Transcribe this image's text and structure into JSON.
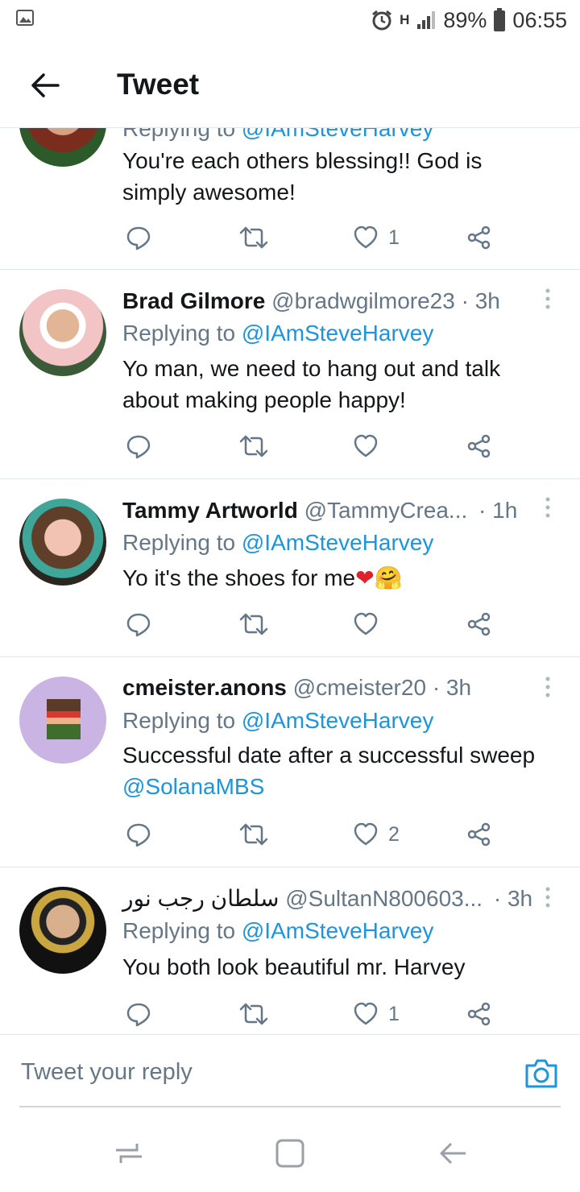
{
  "status_bar": {
    "signal": "H",
    "battery": "89%",
    "time": "06:55"
  },
  "header": {
    "title": "Tweet"
  },
  "tweets": [
    {
      "name": "",
      "handle": "",
      "time": "",
      "replying_prefix": "Replying to",
      "replying_to": "@IAmSteveHarvey",
      "text": "You're each others blessing!!  God is simply awesome!",
      "likes": "1"
    },
    {
      "name": "Brad Gilmore",
      "handle": "@bradwgilmore23",
      "time": "· 3h",
      "replying_prefix": "Replying to",
      "replying_to": "@IAmSteveHarvey",
      "text": "Yo man, we need to hang out and talk about making people happy!",
      "likes": ""
    },
    {
      "name": "Tammy Artworld",
      "handle": "@TammyCrea...",
      "time": "· 1h",
      "replying_prefix": "Replying to",
      "replying_to": "@IAmSteveHarvey",
      "text": "Yo it's the shoes for me",
      "text_emoji": "❤🤗",
      "likes": ""
    },
    {
      "name": "cmeister.anons",
      "handle": "@cmeister20",
      "time": "· 3h",
      "replying_prefix": "Replying to",
      "replying_to": "@IAmSteveHarvey",
      "text": "Successful date after a successful sweep",
      "text_mention": "@SolanaMBS",
      "likes": "2"
    },
    {
      "name": "سلطان رجب نور",
      "handle": "@SultanN800603...",
      "time": "· 3h",
      "replying_prefix": "Replying to",
      "replying_to": "@IAmSteveHarvey",
      "text": "You both look beautiful mr. Harvey",
      "likes": "1"
    }
  ],
  "composer": {
    "placeholder": "Tweet your reply"
  },
  "colors": {
    "link": "#1b95e0",
    "secondary_text": "#657786",
    "divider": "#e1e8ed"
  },
  "icons": [
    "back-arrow-icon",
    "reply-icon",
    "retweet-icon",
    "like-icon",
    "share-icon",
    "more-icon",
    "camera-icon"
  ]
}
